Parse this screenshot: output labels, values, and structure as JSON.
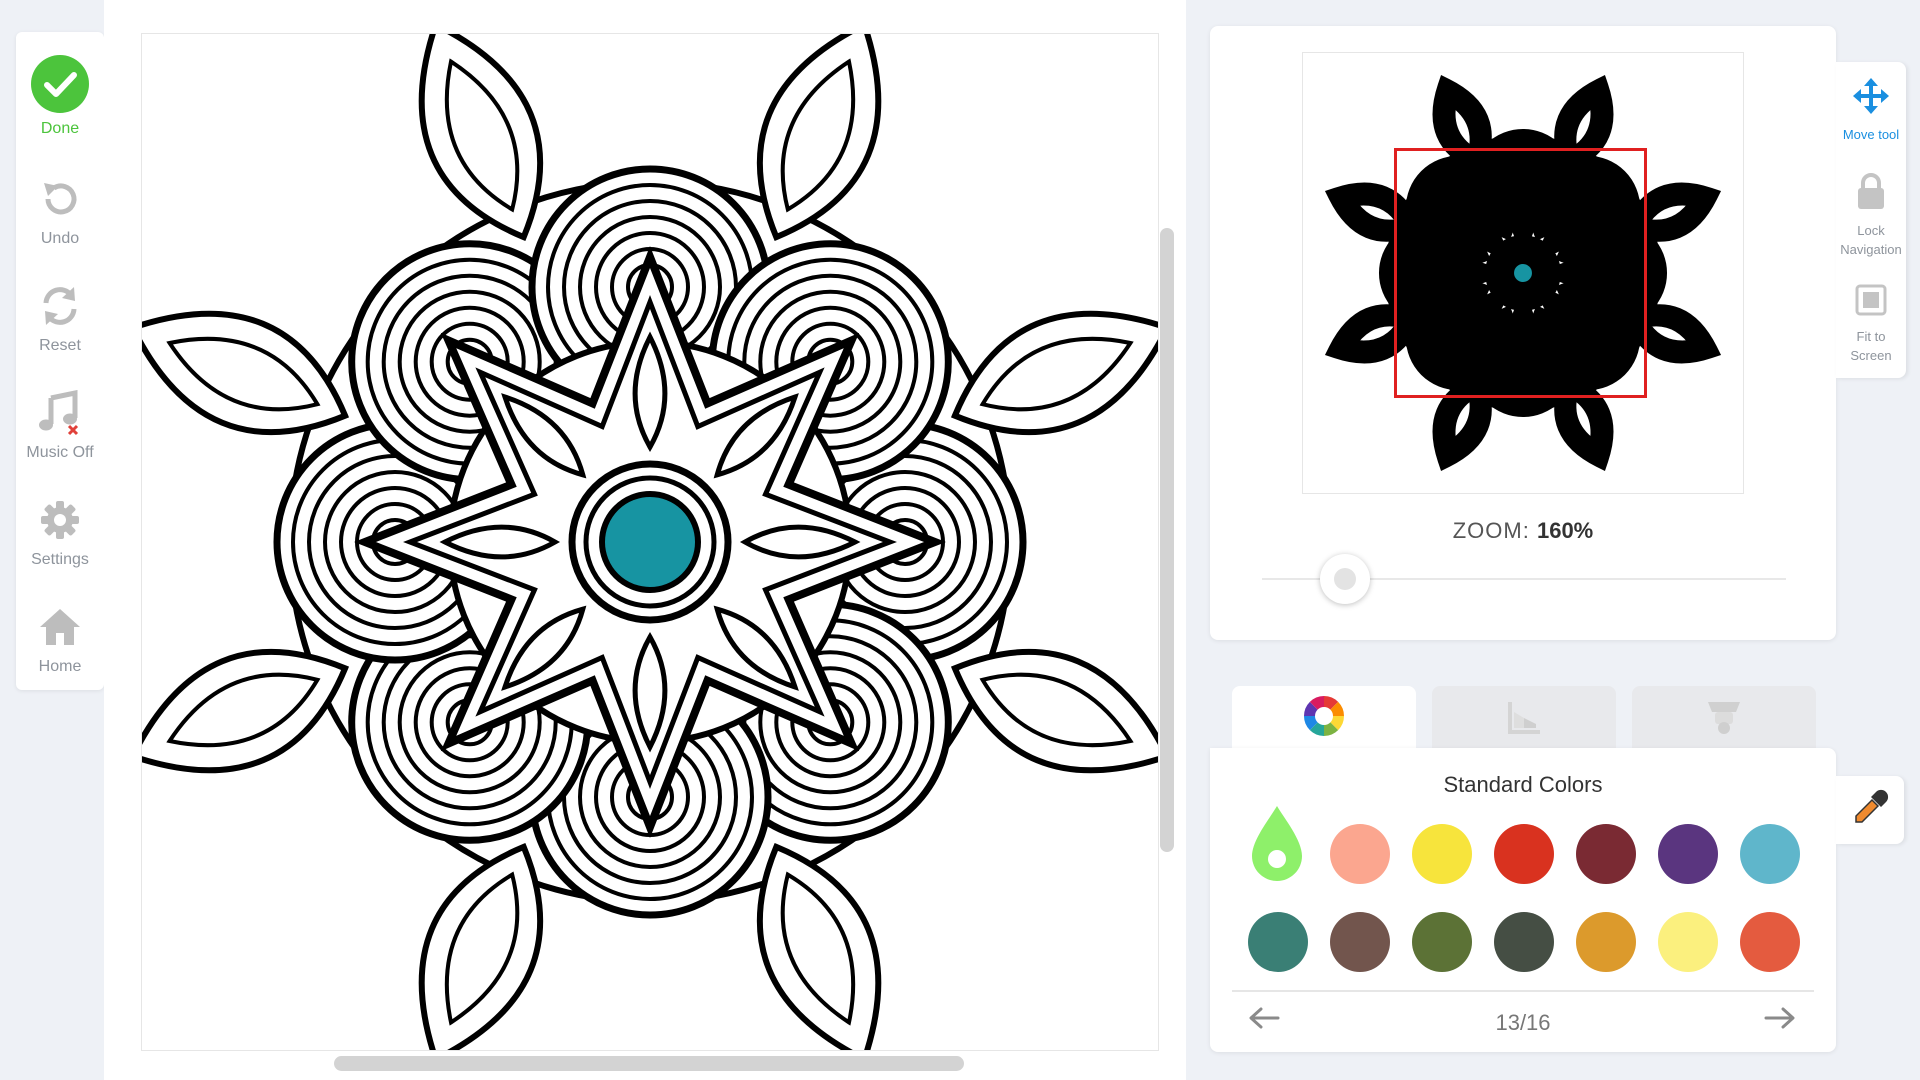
{
  "sidebar": {
    "items": [
      {
        "label": "Done",
        "icon": "check-icon"
      },
      {
        "label": "Undo",
        "icon": "undo-icon"
      },
      {
        "label": "Reset",
        "icon": "reset-icon"
      },
      {
        "label": "Music Off",
        "icon": "music-off-icon"
      },
      {
        "label": "Settings",
        "icon": "gear-icon"
      },
      {
        "label": "Home",
        "icon": "home-icon"
      }
    ]
  },
  "canvas": {
    "center_fill_color": "#1794a2",
    "line_color": "#000000"
  },
  "navigator": {
    "zoom_label": "ZOOM:",
    "zoom_value": "160%",
    "zoom_percent": 160,
    "viewport_color": "#e02020"
  },
  "tools": {
    "move": "Move tool",
    "lock_line1": "Lock",
    "lock_line2": "Navigation",
    "fit_line1": "Fit to",
    "fit_line2": "Screen"
  },
  "tabs": [
    {
      "name": "color-wheel",
      "active": true
    },
    {
      "name": "gradients",
      "active": false
    },
    {
      "name": "brushes",
      "active": false
    }
  ],
  "palette": {
    "title": "Standard Colors",
    "page": "13/16",
    "selected_color": "#8ef06a",
    "colors_row1": [
      "#fba68f",
      "#f7e43c",
      "#d9321f",
      "#7a2a33",
      "#5a357f",
      "#5fb6cb"
    ],
    "colors_row2": [
      "#3a7f75",
      "#72554d",
      "#5c7236",
      "#454e44",
      "#dc9a2c",
      "#fbf07e",
      "#e45b3f"
    ]
  }
}
